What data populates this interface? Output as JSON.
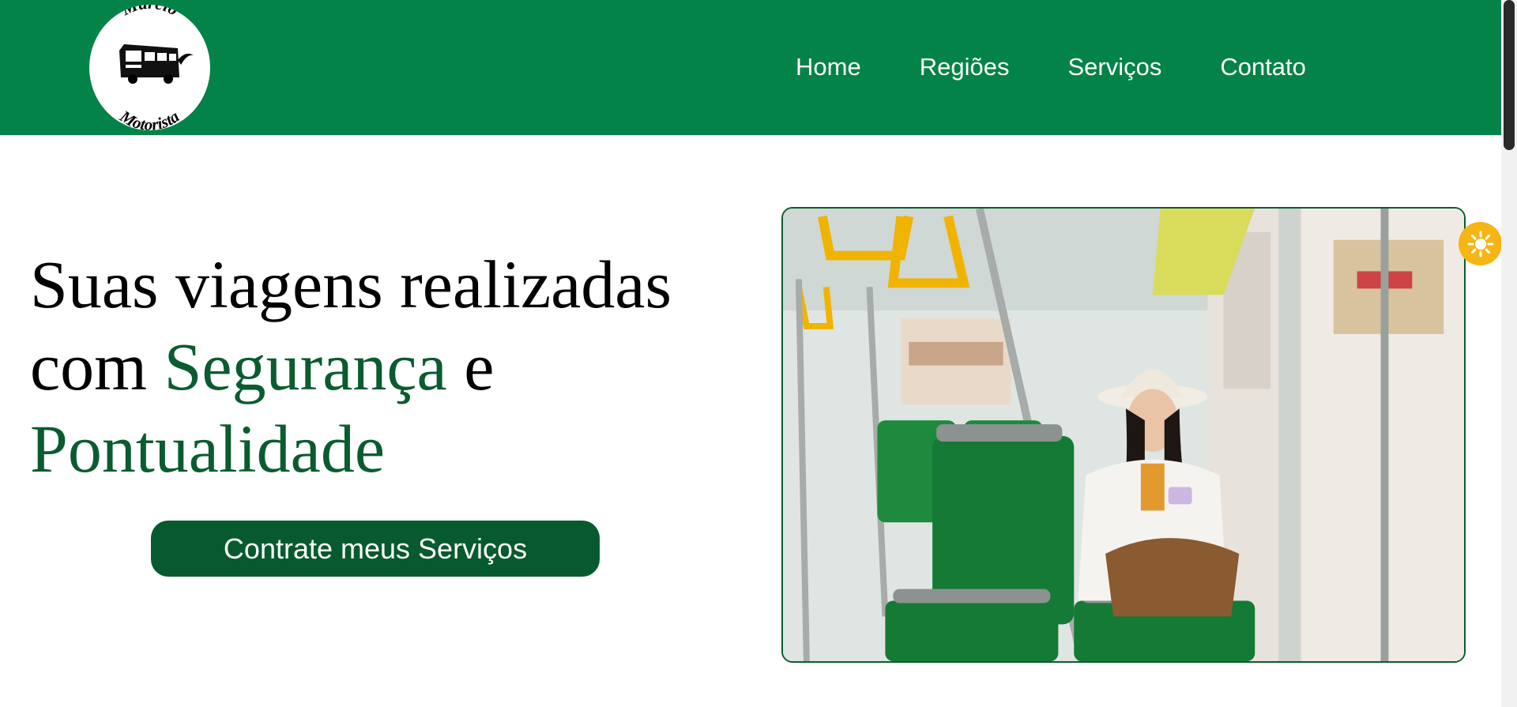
{
  "header": {
    "logo": {
      "line1": "Márcio",
      "line2": "Motorista",
      "icon": "bus-icon"
    },
    "nav": [
      {
        "label": "Home"
      },
      {
        "label": "Regiões"
      },
      {
        "label": "Serviços"
      },
      {
        "label": "Contato"
      }
    ]
  },
  "hero": {
    "title_part1": "Suas viagens realizadas com ",
    "title_highlight1": "Segurança",
    "title_part2": " e ",
    "title_highlight2": "Pontualidade",
    "cta_label": "Contrate meus Serviços",
    "image": {
      "subject": "woman-on-bus-photo"
    }
  },
  "theme_toggle": {
    "icon": "sun-icon"
  },
  "colors": {
    "header_bg": "#048348",
    "accent_text": "#0a5c30",
    "cta_bg": "#075a2d",
    "toggle_bg": "#f6b515"
  }
}
